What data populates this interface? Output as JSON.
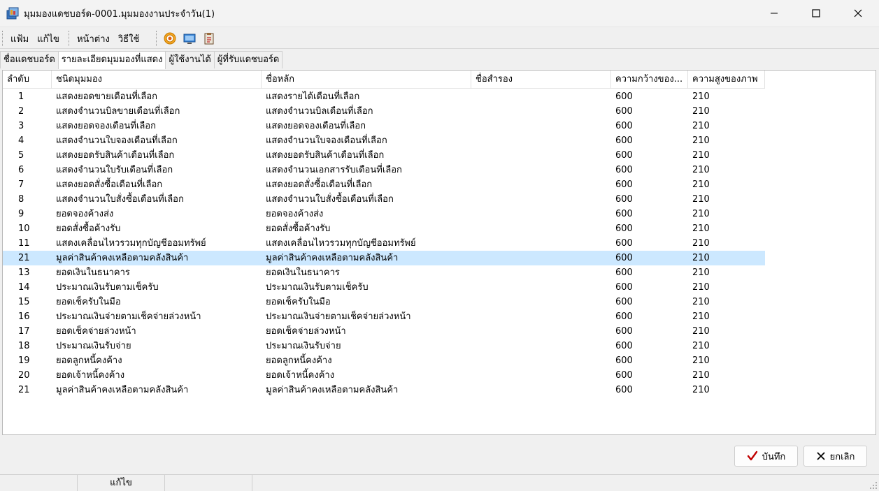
{
  "window": {
    "title": "มุมมองแดชบอร์ด-0001.มุมมองงานประจำวัน(1)",
    "icon": "dashboard-app-icon"
  },
  "menu": {
    "items": [
      "แฟ้ม",
      "แก้ไข",
      "หน้าต่าง",
      "วิธีใช้"
    ],
    "toolbar_icons": [
      "target-icon",
      "monitor-icon",
      "clipboard-icon"
    ]
  },
  "tabs": [
    {
      "label": "ชื่อแดชบอร์ด",
      "active": false
    },
    {
      "label": "รายละเอียดมุมมองที่แสดง",
      "active": true
    },
    {
      "label": "ผู้ใช้งานได้",
      "active": false
    },
    {
      "label": "ผู้ที่รับแดชบอร์ด",
      "active": false
    }
  ],
  "grid": {
    "columns": [
      "ลำดับ",
      "ชนิดมุมมอง",
      "ชื่อหลัก",
      "ชื่อสำรอง",
      "ความกว้างของ...",
      "ความสูงของภาพ"
    ],
    "selected_index": 11,
    "rows": [
      [
        "1",
        "แสดงยอดขายเดือนที่เลือก",
        "แสดงรายได้เดือนที่เลือก",
        "",
        "600",
        "210"
      ],
      [
        "2",
        "แสดงจำนวนบิลขายเดือนที่เลือก",
        "แสดงจำนวนบิลเดือนที่เลือก",
        "",
        "600",
        "210"
      ],
      [
        "3",
        "แสดงยอดจองเดือนที่เลือก",
        "แสดงยอดจองเดือนที่เลือก",
        "",
        "600",
        "210"
      ],
      [
        "4",
        "แสดงจำนวนใบจองเดือนที่เลือก",
        "แสดงจำนวนใบจองเดือนที่เลือก",
        "",
        "600",
        "210"
      ],
      [
        "5",
        "แสดงยอดรับสินค้าเดือนที่เลือก",
        "แสดงยอดรับสินค้าเดือนที่เลือก",
        "",
        "600",
        "210"
      ],
      [
        "6",
        "แสดงจำนวนใบรับเดือนที่เลือก",
        "แสดงจำนวนเอกสารรับเดือนที่เลือก",
        "",
        "600",
        "210"
      ],
      [
        "7",
        "แสดงยอดสั่งซื้อเดือนที่เลือก",
        "แสดงยอดสั่งซื้อเดือนที่เลือก",
        "",
        "600",
        "210"
      ],
      [
        "8",
        "แสดงจำนวนใบสั่งซื้อเดือนที่เลือก",
        "แสดงจำนวนใบสั่งซื้อเดือนที่เลือก",
        "",
        "600",
        "210"
      ],
      [
        "9",
        "ยอดจองค้างส่ง",
        "ยอดจองค้างส่ง",
        "",
        "600",
        "210"
      ],
      [
        "10",
        "ยอดสั่งซื้อค้างรับ",
        "ยอดสั่งซื้อค้างรับ",
        "",
        "600",
        "210"
      ],
      [
        "11",
        "แสดงเคลื่อนไหวรวมทุกบัญชีออมทรัพย์",
        "แสดงเคลื่อนไหวรวมทุกบัญชีออมทรัพย์",
        "",
        "600",
        "210"
      ],
      [
        "21",
        "มูลค่าสินค้าคงเหลือตามคลังสินค้า",
        "มูลค่าสินค้าคงเหลือตามคลังสินค้า",
        "",
        "600",
        "210"
      ],
      [
        "13",
        "ยอดเงินในธนาคาร",
        "ยอดเงินในธนาคาร",
        "",
        "600",
        "210"
      ],
      [
        "14",
        "ประมาณเงินรับตามเช็ครับ",
        "ประมาณเงินรับตามเช็ครับ",
        "",
        "600",
        "210"
      ],
      [
        "15",
        "ยอดเช็ครับในมือ",
        "ยอดเช็ครับในมือ",
        "",
        "600",
        "210"
      ],
      [
        "16",
        "ประมาณเงินจ่ายตามเช็คจ่ายล่วงหน้า",
        "ประมาณเงินจ่ายตามเช็คจ่ายล่วงหน้า",
        "",
        "600",
        "210"
      ],
      [
        "17",
        "ยอดเช็คจ่ายล่วงหน้า",
        "ยอดเช็คจ่ายล่วงหน้า",
        "",
        "600",
        "210"
      ],
      [
        "18",
        "ประมาณเงินรับจ่าย",
        "ประมาณเงินรับจ่าย",
        "",
        "600",
        "210"
      ],
      [
        "19",
        "ยอดลูกหนี้คงค้าง",
        "ยอดลูกหนี้คงค้าง",
        "",
        "600",
        "210"
      ],
      [
        "20",
        "ยอดเจ้าหนี้คงค้าง",
        "ยอดเจ้าหนี้คงค้าง",
        "",
        "600",
        "210"
      ],
      [
        "21",
        "มูลค่าสินค้าคงเหลือตามคลังสินค้า",
        "มูลค่าสินค้าคงเหลือตามคลังสินค้า",
        "",
        "600",
        "210"
      ]
    ]
  },
  "buttons": {
    "save_label": "บันทึก",
    "cancel_label": "ยกเลิก"
  },
  "status": {
    "mode": "แก้ไข"
  },
  "colors": {
    "selected_row": "#cce8ff",
    "save_check": "#c00000"
  }
}
